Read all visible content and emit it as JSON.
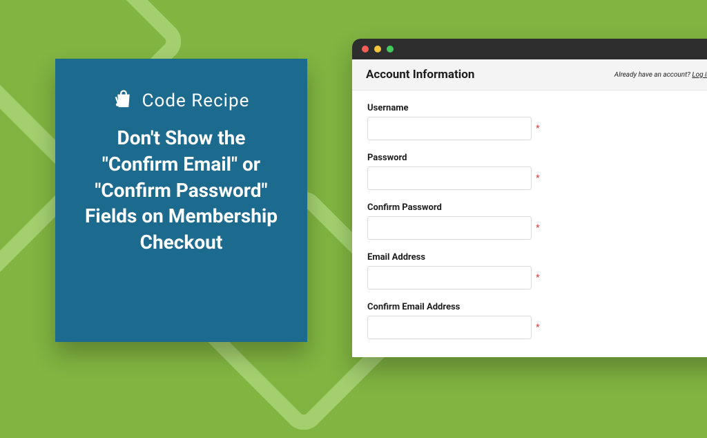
{
  "brand": {
    "name": "Code Recipe"
  },
  "headline": "Don't Show the \"Confirm Email\" or \"Confirm Password\" Fields on Membership Checkout",
  "form": {
    "section_title": "Account Information",
    "login_prompt_prefix": "Already have an account? ",
    "login_link": "Log in here",
    "required_marker": "*",
    "fields": {
      "username": {
        "label": "Username",
        "value": ""
      },
      "password": {
        "label": "Password",
        "value": ""
      },
      "confirm_password": {
        "label": "Confirm Password",
        "value": ""
      },
      "email": {
        "label": "Email Address",
        "value": ""
      },
      "confirm_email": {
        "label": "Confirm Email Address",
        "value": ""
      }
    }
  },
  "colors": {
    "bg": "#81b441",
    "card": "#1d6a8f",
    "required": "#d93a3a"
  }
}
